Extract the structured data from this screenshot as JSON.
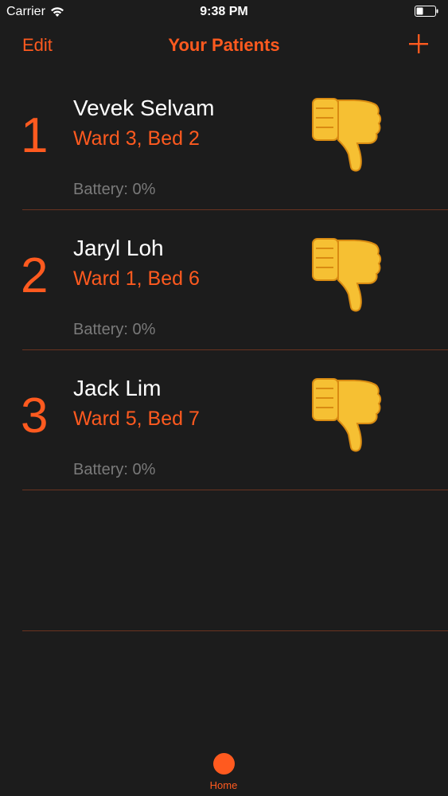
{
  "status_bar": {
    "carrier": "Carrier",
    "time": "9:38 PM"
  },
  "nav": {
    "edit_label": "Edit",
    "title": "Your Patients",
    "add_icon": "plus-icon"
  },
  "patients": [
    {
      "index": "1",
      "name": "Vevek Selvam",
      "location": "Ward 3, Bed 2",
      "battery": "Battery: 0%",
      "status_icon": "thumbs-down-icon"
    },
    {
      "index": "2",
      "name": "Jaryl Loh",
      "location": "Ward 1, Bed 6",
      "battery": "Battery: 0%",
      "status_icon": "thumbs-down-icon"
    },
    {
      "index": "3",
      "name": "Jack Lim",
      "location": "Ward 5, Bed 7",
      "battery": "Battery: 0%",
      "status_icon": "thumbs-down-icon"
    }
  ],
  "tab_bar": {
    "home_label": "Home"
  },
  "colors": {
    "accent": "#ff5a1f",
    "background": "#1c1c1c",
    "muted_text": "#7a7a7a",
    "divider": "#6a3320",
    "thumb_yellow": "#f6c033"
  }
}
